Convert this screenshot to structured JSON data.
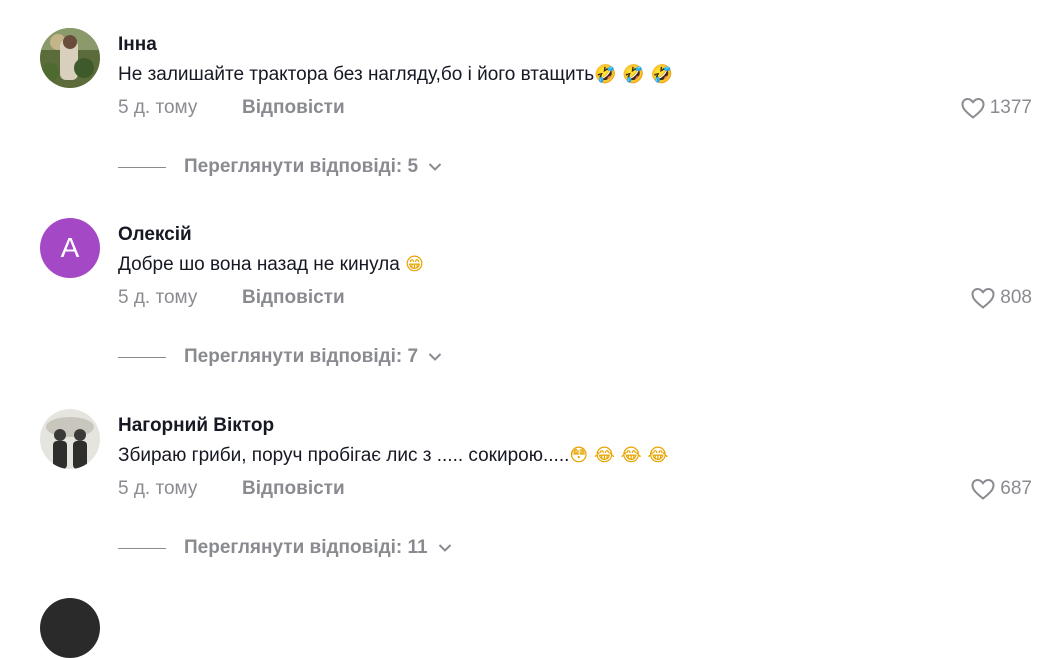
{
  "comments": [
    {
      "username": "Інна",
      "text": "Не залишайте трактора без нагляду,бо і його втащить",
      "emoji": "🤣 🤣 🤣",
      "time": "5 д. тому",
      "reply_label": "Відповісти",
      "likes": "1377",
      "replies_label": "Переглянути відповіді: 5"
    },
    {
      "username": "Олексій",
      "avatar_letter": "A",
      "text": "Добре шо вона назад не кинула",
      "emoji": "😁",
      "time": "5 д. тому",
      "reply_label": "Відповісти",
      "likes": "808",
      "replies_label": "Переглянути відповіді: 7"
    },
    {
      "username": "Нагорний Віктор",
      "text": "Збираю гриби, поруч пробігає лис з ..... сокирою.....",
      "emoji": "😳 😂 😂 😂",
      "time": "5 д. тому",
      "reply_label": "Відповісти",
      "likes": "687",
      "replies_label": "Переглянути відповіді: 11"
    }
  ],
  "colors": {
    "avatar_purple": "#a448c6",
    "muted": "#8a8b91",
    "text": "#161823"
  }
}
